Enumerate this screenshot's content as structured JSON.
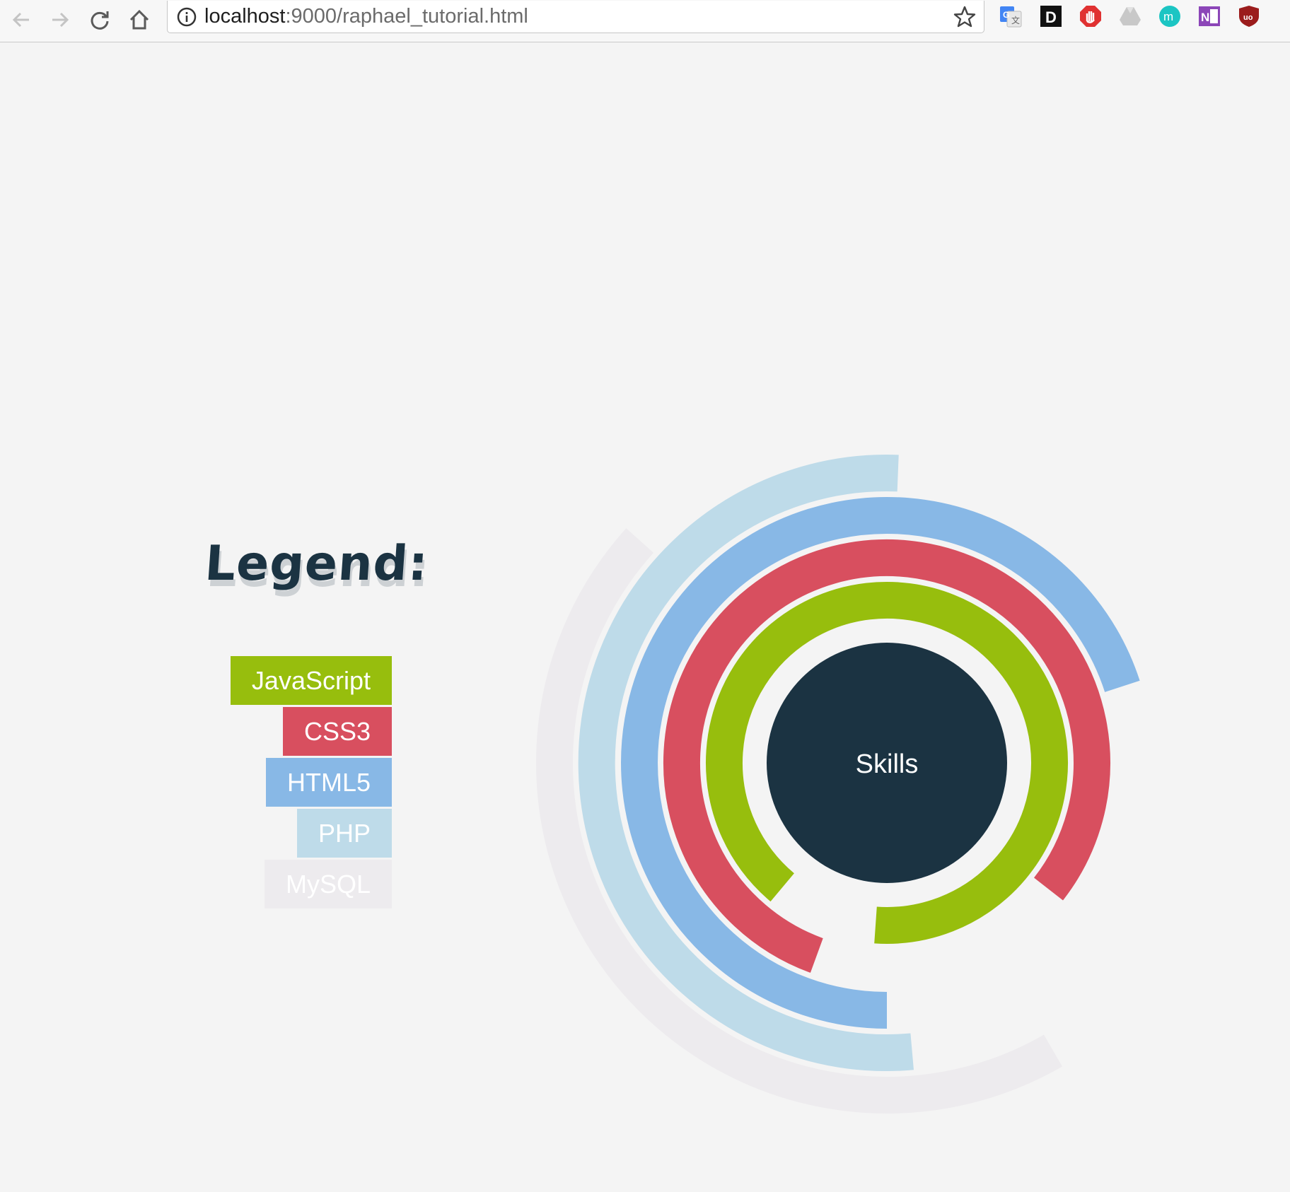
{
  "browser": {
    "url_host": "localhost",
    "url_path": ":9000/raphael_tutorial.html",
    "extensions": [
      "google-translate-icon",
      "d-extension-icon",
      "adblock-icon",
      "google-drive-icon",
      "m-extension-icon",
      "onenote-icon",
      "ublock-icon"
    ]
  },
  "page": {
    "background": "#f4f4f4",
    "legend_title": "Legend:"
  },
  "chart_data": {
    "type": "radial-bar",
    "center_label": "Skills",
    "center_color": "#1b3342",
    "series": [
      {
        "name": "JavaScript",
        "color": "#97be0d",
        "value": 90
      },
      {
        "name": "CSS3",
        "color": "#d84f5f",
        "value": 80
      },
      {
        "name": "HTML5",
        "color": "#88b8e6",
        "value": 70
      },
      {
        "name": "PHP",
        "color": "#bedbe9",
        "value": 52
      },
      {
        "name": "MySQL",
        "color": "#edebee",
        "value": 45
      }
    ]
  }
}
